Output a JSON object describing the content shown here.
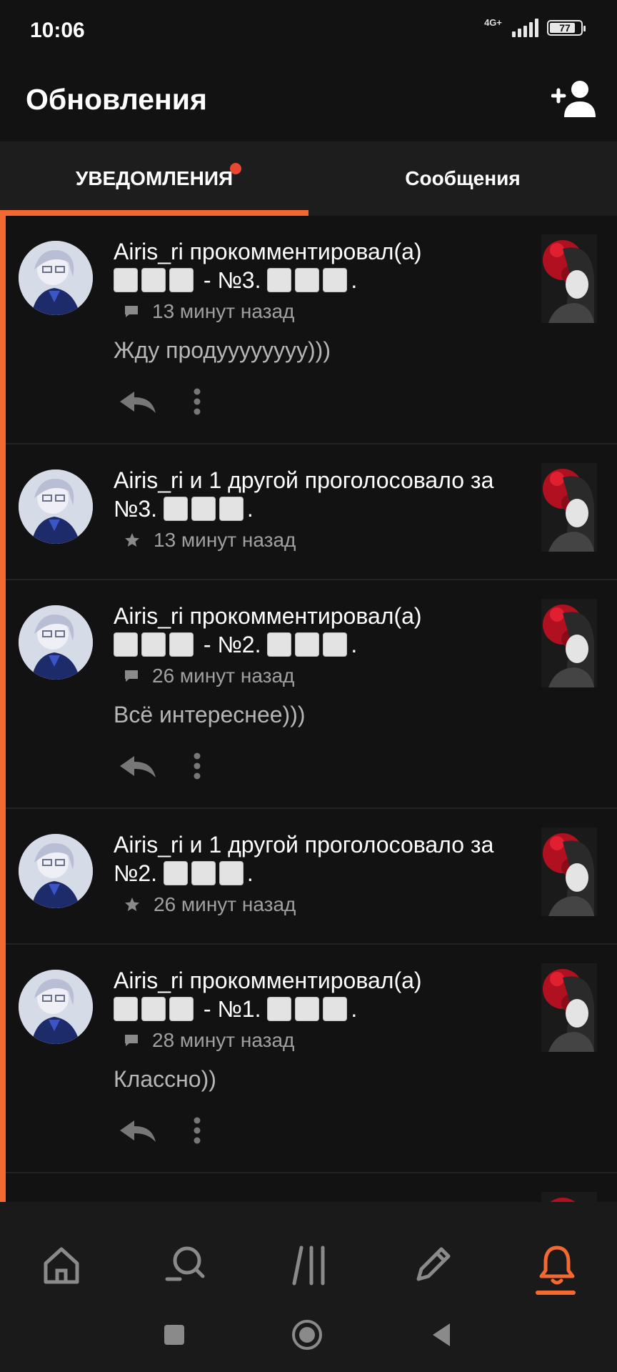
{
  "status_bar": {
    "time": "10:06",
    "network": "4G+",
    "battery": "77"
  },
  "header": {
    "title": "Обновления"
  },
  "tabs": [
    {
      "label": "УВЕДОМЛЕНИЯ",
      "active": true,
      "has_dot": true
    },
    {
      "label": "Сообщения",
      "active": false
    }
  ],
  "feed": [
    {
      "type": "comment",
      "user": "Airis_ri",
      "action": "прокомментировал(а)",
      "target_pre": " - №3. ",
      "time": "13 минут назад",
      "comment": "Жду продуууууууу)))"
    },
    {
      "type": "vote",
      "text": "Airis_ri и 1 другой проголосовало за",
      "target": "№3. ",
      "time": "13 минут назад"
    },
    {
      "type": "comment",
      "user": "Airis_ri",
      "action": "прокомментировал(а)",
      "target_pre": " - №2. ",
      "time": "26 минут назад",
      "comment": "Всё интереснее)))"
    },
    {
      "type": "vote",
      "text": "Airis_ri и 1 другой проголосовало за",
      "target": "№2. ",
      "time": "26 минут назад"
    },
    {
      "type": "comment",
      "user": "Airis_ri",
      "action": "прокомментировал(а)",
      "target_pre": " - №1. ",
      "time": "28 минут назад",
      "comment": "Классно))"
    }
  ],
  "icons": {
    "comment": "speech-bubble-icon",
    "vote": "star-icon",
    "reply": "reply-arrow-icon",
    "more": "vertical-dots-icon"
  },
  "bottom_nav": [
    "home-icon",
    "search-icon",
    "library-icon",
    "pencil-icon",
    "bell-icon"
  ],
  "active_nav": "bell-icon",
  "colors": {
    "accent": "#f26a32",
    "background": "#121212",
    "notification_dot": "#e8482f"
  }
}
